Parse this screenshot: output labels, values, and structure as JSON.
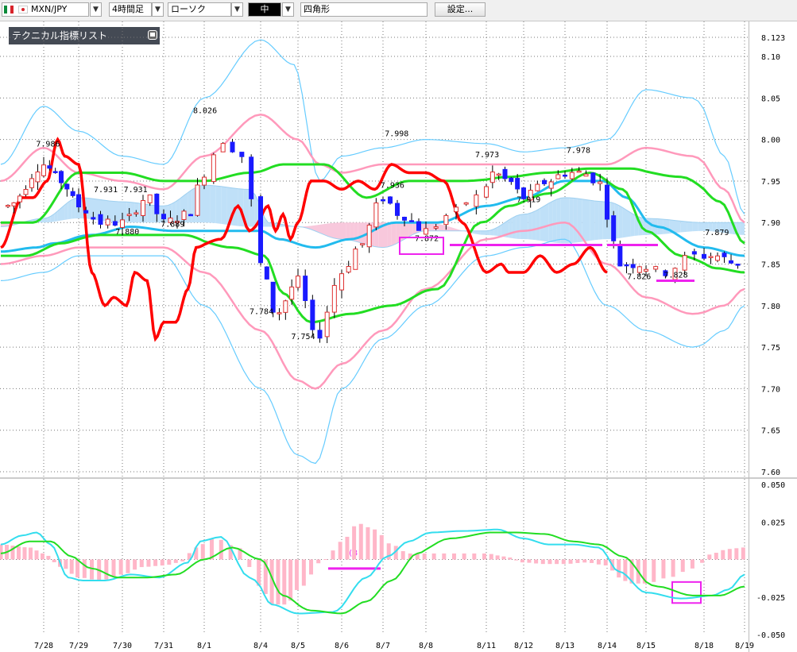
{
  "toolbar": {
    "symbol": "MXN/JPY",
    "timeframe": "4時間足",
    "chart_type": "ローソク",
    "line_width": "中",
    "drawing_tool": "四角形",
    "settings_button": "設定..."
  },
  "indicator_panel": {
    "title": "テクニカル指標リスト"
  },
  "colors": {
    "bull_candle": "#e03030",
    "bear_candle": "#1a1aff",
    "red_line": "#ff0000",
    "bb_outer": "#66ccff",
    "bb_inner": "#ff99bb",
    "sma_green": "#22dd22",
    "sma_blue": "#22bbee",
    "cloud_blue": "#bfe0f8",
    "cloud_pink": "#f8c8dc",
    "annotation": "#ee22ee",
    "macd_hist": "#ffb6c8"
  },
  "chart_data": {
    "type": "candlestick",
    "price_panel": {
      "ylim": [
        7.6,
        8.123
      ],
      "y_ticks": [
        "8.123",
        "8.10",
        "8.05",
        "8.00",
        "7.95",
        "7.90",
        "7.85",
        "7.80",
        "7.75",
        "7.70",
        "7.65",
        "7.60"
      ],
      "x_labels": [
        "7/28",
        "7/29",
        "7/30",
        "7/31",
        "8/1",
        "8/4",
        "8/5",
        "8/6",
        "8/7",
        "8/8",
        "8/11",
        "8/12",
        "8/13",
        "8/14",
        "8/15",
        "8/18",
        "8/19"
      ],
      "price_labels": [
        {
          "text": "7.986",
          "date_index": 0.1
        },
        {
          "text": "7.931",
          "date_index": 1.6
        },
        {
          "text": "7.931",
          "date_index": 2.3
        },
        {
          "text": "7.880",
          "date_index": 2.1
        },
        {
          "text": "7.889",
          "date_index": 3.2
        },
        {
          "text": "8.026",
          "date_index": 4.0
        },
        {
          "text": "7.784",
          "date_index": 5.0
        },
        {
          "text": "7.754",
          "date_index": 6.1
        },
        {
          "text": "7.998",
          "date_index": 8.3
        },
        {
          "text": "7.936",
          "date_index": 8.2
        },
        {
          "text": "7.872",
          "date_index": 9.0
        },
        {
          "text": "7.973",
          "date_index": 10.0
        },
        {
          "text": "7.919",
          "date_index": 11.1
        },
        {
          "text": "7.978",
          "date_index": 12.3
        },
        {
          "text": "7.826",
          "date_index": 13.8
        },
        {
          "text": "7.828",
          "date_index": 14.5
        },
        {
          "text": "7.879",
          "date_index": 15.3
        }
      ]
    },
    "macd_panel": {
      "ylim": [
        -0.05,
        0.05
      ],
      "y_ticks": [
        "0.050",
        "0.025",
        "-0.025",
        "-0.050"
      ],
      "annotation": "(8)"
    }
  }
}
